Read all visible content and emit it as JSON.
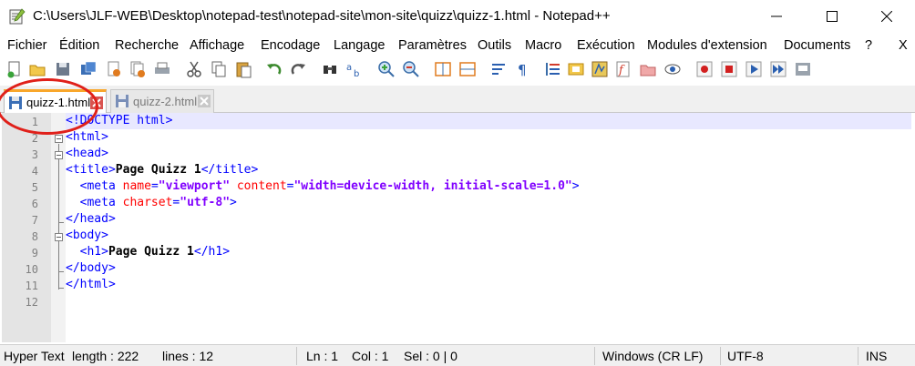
{
  "window": {
    "title": "C:\\Users\\JLF-WEB\\Desktop\\notepad-test\\notepad-site\\mon-site\\quizz\\quizz-1.html - Notepad++",
    "minimize_label": "—",
    "maximize_label": "☐",
    "close_label": "✕"
  },
  "menu": {
    "items": [
      "Fichier",
      "Édition",
      "Recherche",
      "Affichage",
      "Encodage",
      "Langage",
      "Paramètres",
      "Outils",
      "Macro",
      "Exécution",
      "Modules d'extension",
      "Documents",
      "?"
    ],
    "close_label": "X"
  },
  "tabs": [
    {
      "label": "quizz-1.html",
      "active": true
    },
    {
      "label": "quizz-2.html",
      "active": false
    }
  ],
  "editor": {
    "line_numbers": [
      "1",
      "2",
      "3",
      "4",
      "5",
      "6",
      "7",
      "8",
      "9",
      "10",
      "11",
      "12"
    ],
    "current_line": 1
  },
  "status": {
    "file_type": "Hyper Text",
    "length": "length : 222",
    "lines": "lines : 12",
    "ln": "Ln : 1",
    "col": "Col : 1",
    "sel": "Sel : 0 | 0",
    "eol": "Windows (CR LF)",
    "encoding": "UTF-8",
    "mode": "INS"
  },
  "colors": {
    "tag": "#0000ff",
    "attribute": "#ff0000",
    "value": "#8000ff",
    "active_tab_accent": "#f9a72b",
    "annotation_circle": "#e0201a"
  }
}
